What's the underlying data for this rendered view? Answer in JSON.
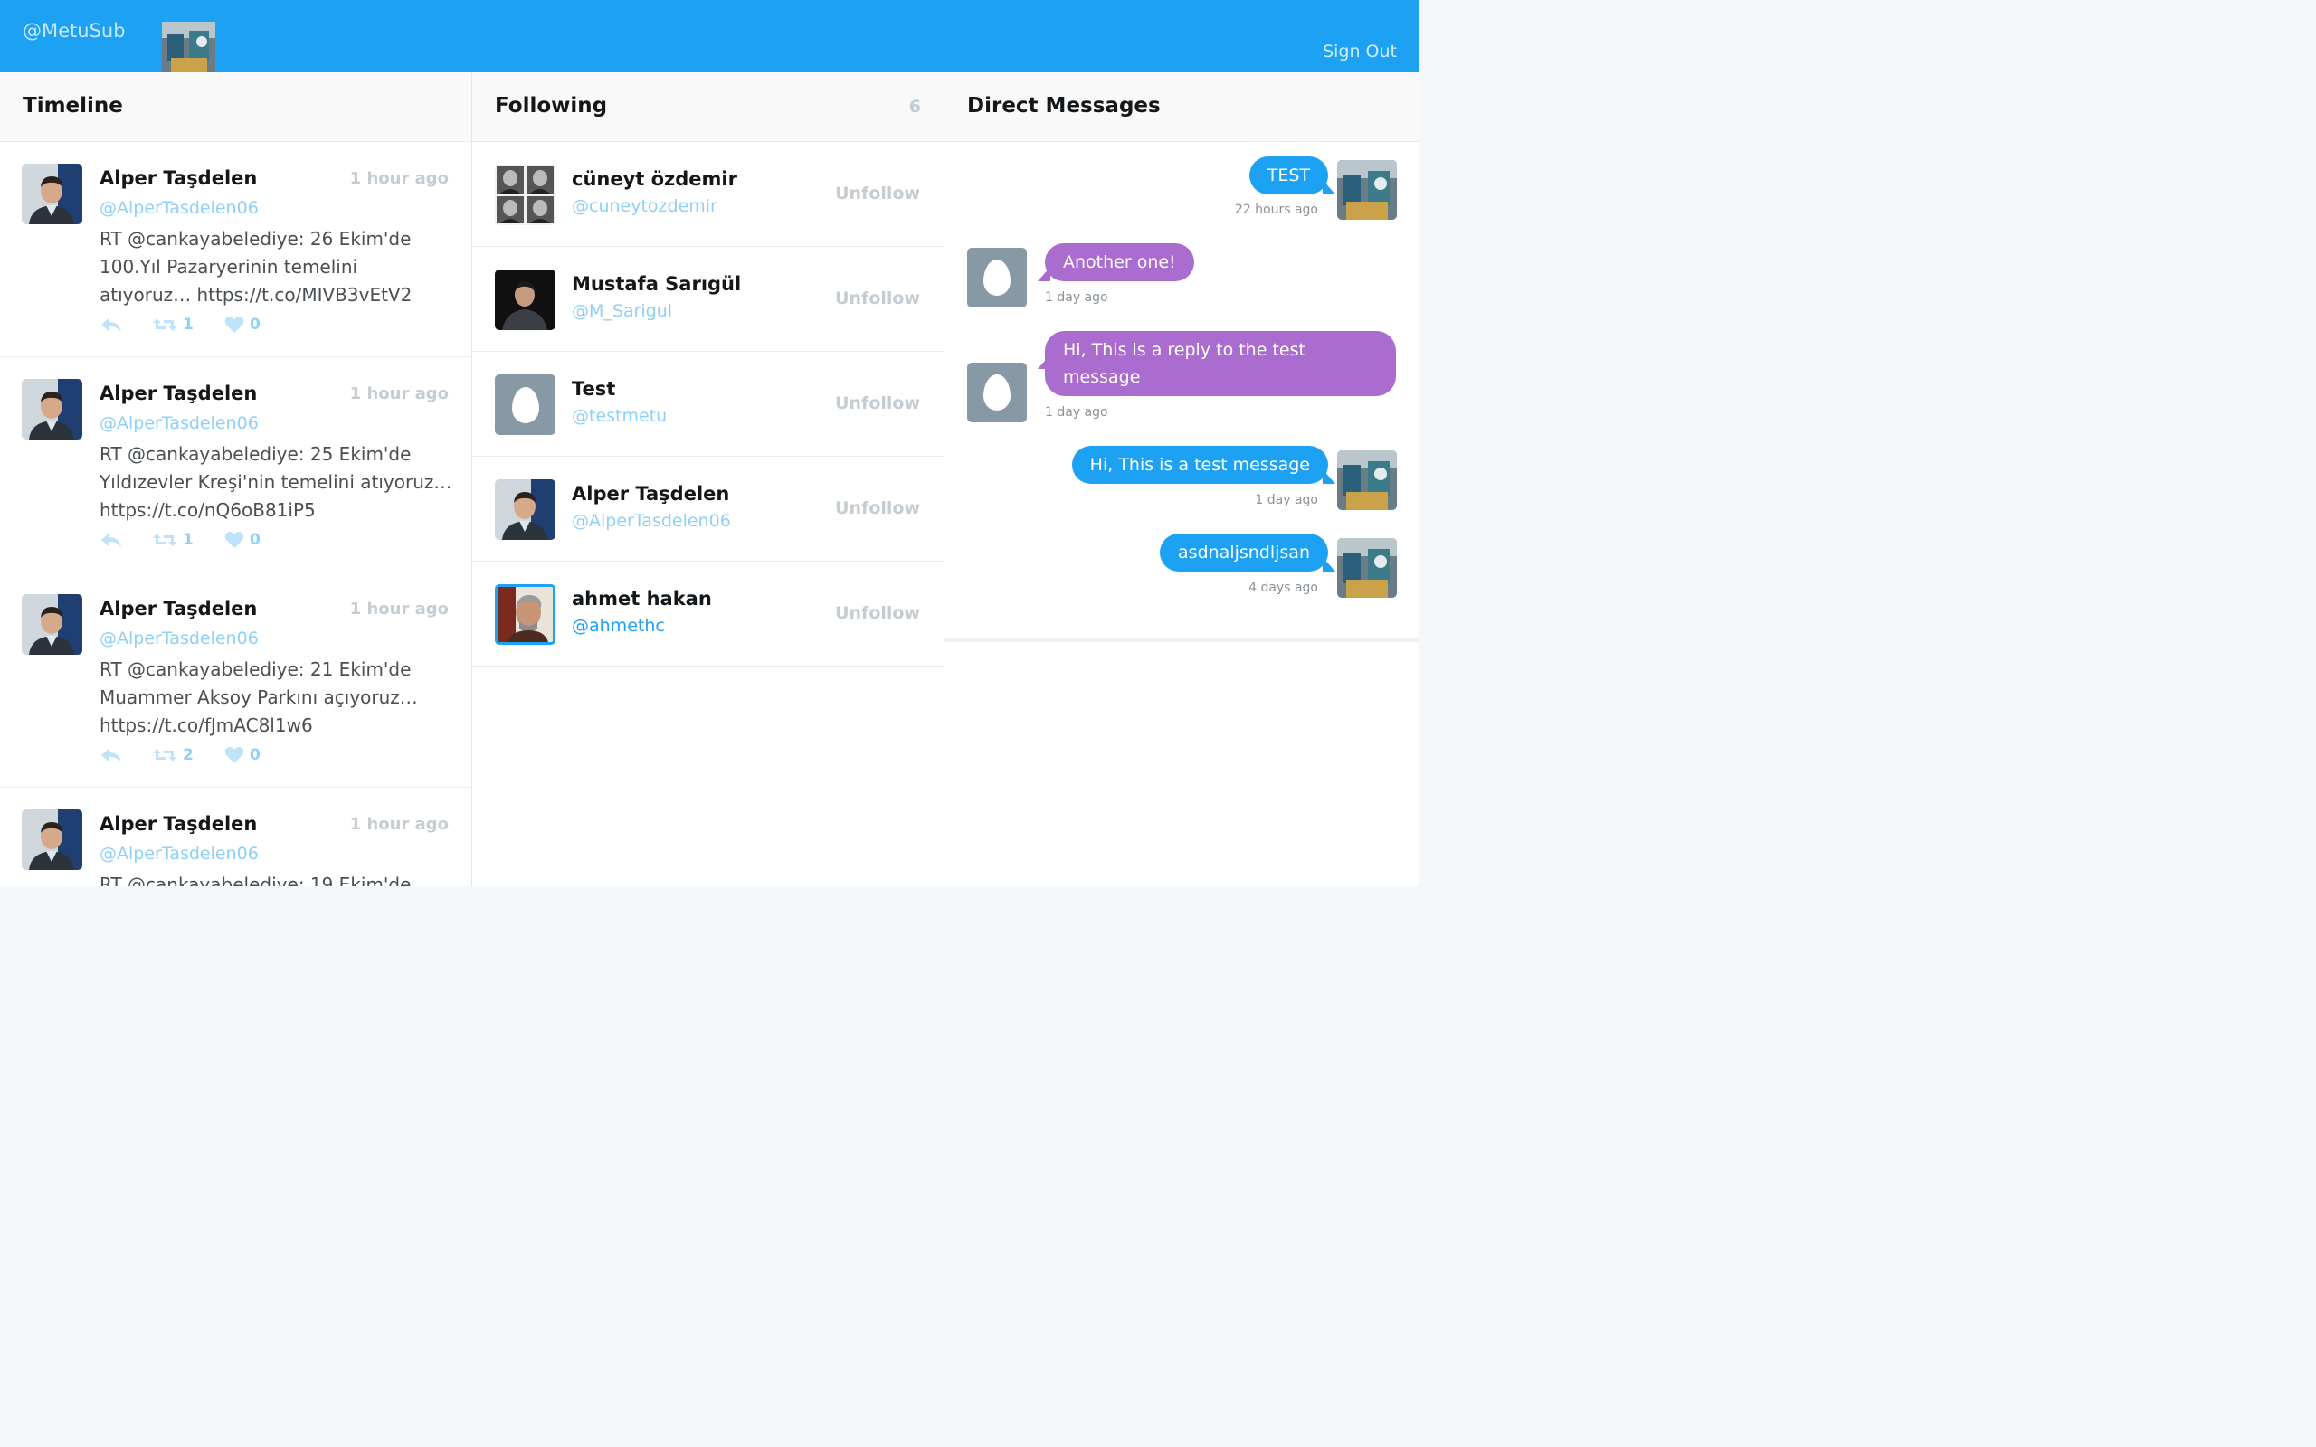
{
  "header": {
    "brand": "@MetuSub",
    "sign_out": "Sign Out"
  },
  "timeline": {
    "title": "Timeline",
    "tweets": [
      {
        "name": "Alper Taşdelen",
        "handle": "@AlperTasdelen06",
        "time": "1 hour ago",
        "text": "RT @cankayabelediye: 26 Ekim'de 100.Yıl Pazaryerinin temelini atıyoruz… https://t.co/MIVB3vEtV2",
        "retweets": "1",
        "likes": "0"
      },
      {
        "name": "Alper Taşdelen",
        "handle": "@AlperTasdelen06",
        "time": "1 hour ago",
        "text": "RT @cankayabelediye: 25 Ekim'de Yıldızevler Kreşi'nin temelini atıyoruz… https://t.co/nQ6oB81iP5",
        "retweets": "1",
        "likes": "0"
      },
      {
        "name": "Alper Taşdelen",
        "handle": "@AlperTasdelen06",
        "time": "1 hour ago",
        "text": "RT @cankayabelediye: 21 Ekim'de Muammer Aksoy Parkını açıyoruz… https://t.co/fJmAC8l1w6",
        "retweets": "2",
        "likes": "0"
      },
      {
        "name": "Alper Taşdelen",
        "handle": "@AlperTasdelen06",
        "time": "1 hour ago",
        "text": "RT @cankayabelediye: 19 Ekim'de",
        "retweets": "",
        "likes": ""
      }
    ]
  },
  "following": {
    "title": "Following",
    "count": "6",
    "unfollow_label": "Unfollow",
    "users": [
      {
        "name": "cüneyt özdemir",
        "handle": "@cuneytozdemir"
      },
      {
        "name": "Mustafa Sarıgül",
        "handle": "@M_Sarigul"
      },
      {
        "name": "Test",
        "handle": "@testmetu"
      },
      {
        "name": "Alper Taşdelen",
        "handle": "@AlperTasdelen06"
      },
      {
        "name": "ahmet hakan",
        "handle": "@ahmethc"
      }
    ]
  },
  "dm": {
    "title": "Direct Messages",
    "messages": [
      {
        "text": "TEST",
        "time": "22 hours ago",
        "direction": "out"
      },
      {
        "text": "Another one!",
        "time": "1 day ago",
        "direction": "in"
      },
      {
        "text": "Hi, This is a reply to the test message",
        "time": "1 day ago",
        "direction": "in"
      },
      {
        "text": "Hi, This is a test message",
        "time": "1 day ago",
        "direction": "out"
      },
      {
        "text": "asdnaljsndljsan",
        "time": "4 days ago",
        "direction": "out"
      }
    ]
  },
  "colors": {
    "accent": "#1da1f2",
    "incoming_bubble": "#ab6cd0",
    "muted": "#c5cdd3",
    "handle": "#8ed0f9"
  }
}
